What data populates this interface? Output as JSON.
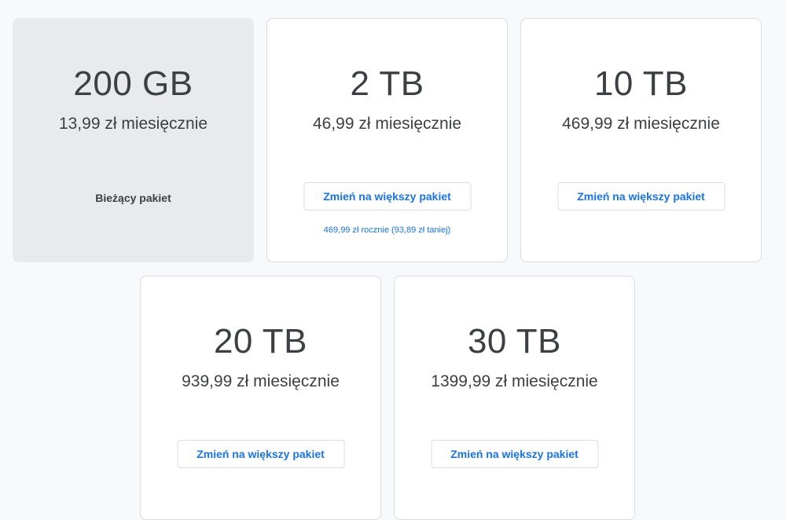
{
  "plans": [
    {
      "size": "200 GB",
      "price": "13,99 zł miesięcznie",
      "status": "Bieżący pakiet"
    },
    {
      "size": "2 TB",
      "price": "46,99 zł miesięcznie",
      "button": "Zmień na większy pakiet",
      "yearly": "469,99 zł rocznie (93,89 zł taniej)"
    },
    {
      "size": "10 TB",
      "price": "469,99 zł miesięcznie",
      "button": "Zmień na większy pakiet"
    },
    {
      "size": "20 TB",
      "price": "939,99 zł miesięcznie",
      "button": "Zmień na większy pakiet"
    },
    {
      "size": "30 TB",
      "price": "1399,99 zł miesięcznie",
      "button": "Zmień na większy pakiet"
    }
  ],
  "colors": {
    "accent": "#1a73e8",
    "text": "#3c4043",
    "current_card_bg": "#e8eaed",
    "border": "#dadce0",
    "page_bg": "#f8f9fa"
  }
}
